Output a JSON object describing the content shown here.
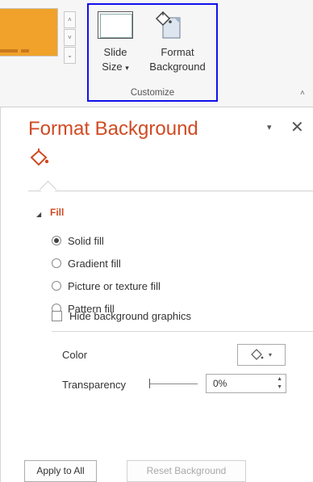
{
  "ribbon": {
    "slide_size_label_line1": "Slide",
    "slide_size_label_line2": "Size",
    "slide_size_caret": "▾",
    "format_background_label_line1": "Format",
    "format_background_label_line2": "Background",
    "group_label": "Customize",
    "scroll_up": "˄",
    "scroll_down": "˅",
    "scroll_more": "⌄",
    "collapse_caret": "˄"
  },
  "pane": {
    "title": "Format Background",
    "menu_icon": "▾",
    "close_icon": "✕",
    "section_arrow": "◢",
    "section_title": "Fill",
    "fill_options": [
      {
        "label": "Solid fill",
        "selected": true
      },
      {
        "label": "Gradient fill",
        "selected": false
      },
      {
        "label": "Picture or texture fill",
        "selected": false
      },
      {
        "label": "Pattern fill",
        "selected": false
      }
    ],
    "hide_graphics_label": "Hide background graphics",
    "hide_graphics_checked": false,
    "color_label": "Color",
    "color_caret": "▾",
    "transparency_label": "Transparency",
    "transparency_value": "0%",
    "transparency_level": 0,
    "spin_up": "▲",
    "spin_down": "▼"
  },
  "buttons": {
    "apply_all": "Apply to All",
    "reset": "Reset Background"
  },
  "colors": {
    "accent": "#d04a23",
    "theme_orange": "#f0a22a",
    "highlight_border": "#1010ee"
  }
}
